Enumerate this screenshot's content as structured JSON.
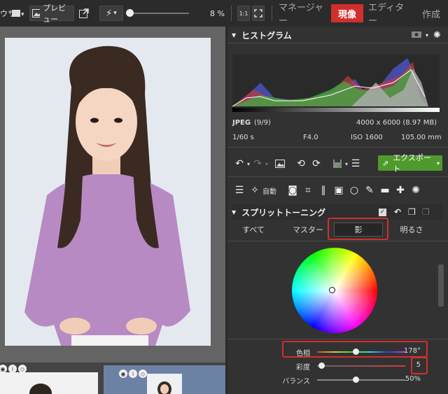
{
  "toolbar": {
    "left_fragment": "ウサ",
    "preview_label": "プレビュー",
    "zoom_value": "8 %",
    "zoom_1to1": "1:1"
  },
  "modes": [
    {
      "label": "マネージャー"
    },
    {
      "label": "現像"
    },
    {
      "label": "エディター"
    },
    {
      "label": "作成"
    }
  ],
  "histogram": {
    "title": "ヒストグラム",
    "format": "JPEG",
    "count": "(9/9)",
    "dimensions": "4000 x 6000 (8.97 MB)",
    "shutter": "1/60 s",
    "aperture": "F4.0",
    "iso": "ISO 1600",
    "focal": "105.00 mm"
  },
  "export": {
    "label": "エクスポート"
  },
  "tools": {
    "auto_label": "自動"
  },
  "split_toning": {
    "title": "スプリットトーニング",
    "tabs": [
      {
        "label": "すべて"
      },
      {
        "label": "マスター"
      },
      {
        "label": "影"
      },
      {
        "label": "明るさ"
      }
    ],
    "sliders": [
      {
        "label": "色相",
        "value": "178°",
        "level": 0.5
      },
      {
        "label": "彩度",
        "value": "5",
        "level": 0.05
      },
      {
        "label": "バランス",
        "value": "50%",
        "level": 0.5
      }
    ]
  },
  "colors": {
    "accent": "#d0302d",
    "export_green": "#4f9a2d",
    "panel_bg": "#323232"
  }
}
